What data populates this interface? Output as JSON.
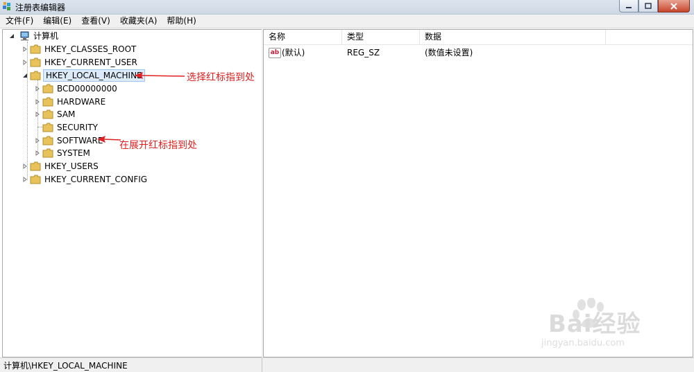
{
  "window": {
    "title": "注册表编辑器"
  },
  "menu": [
    "文件(F)",
    "编辑(E)",
    "查看(V)",
    "收藏夹(A)",
    "帮助(H)"
  ],
  "tree": {
    "root": "计算机",
    "hives": [
      "HKEY_CLASSES_ROOT",
      "HKEY_CURRENT_USER",
      "HKEY_LOCAL_MACHINE",
      "HKEY_USERS",
      "HKEY_CURRENT_CONFIG"
    ],
    "local_machine_children": [
      "BCD00000000",
      "HARDWARE",
      "SAM",
      "SECURITY",
      "SOFTWARE",
      "SYSTEM"
    ],
    "selected": "HKEY_LOCAL_MACHINE"
  },
  "list": {
    "columns": [
      "名称",
      "类型",
      "数据"
    ],
    "rows": [
      {
        "name": "(默认)",
        "type": "REG_SZ",
        "data": "(数值未设置)"
      }
    ]
  },
  "status": {
    "path": "计算机\\HKEY_LOCAL_MACHINE"
  },
  "annotations": {
    "select": "选择红标指到处",
    "expand": "在展开红标指到处"
  },
  "watermark": {
    "brand": "Bai经验",
    "url": "jingyan.baidu.com"
  },
  "colors": {
    "annotation": "#e02020",
    "selection": "#dceaf9",
    "folder": "#e8c25a"
  }
}
